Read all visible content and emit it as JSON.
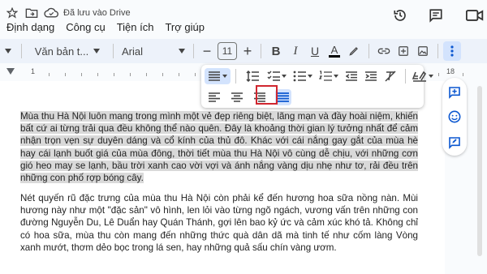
{
  "header": {
    "save_status": "Đã lưu vào Drive",
    "menus": [
      "Định dạng",
      "Công cụ",
      "Tiện ích",
      "Trợ giúp"
    ]
  },
  "toolbar": {
    "style_dropdown": "Văn bản t...",
    "font_dropdown": "Arial",
    "font_size": "11"
  },
  "ruler": {
    "left_label": "1",
    "right_label": "18"
  },
  "document": {
    "paragraph1": "Mùa thu Hà Nội luôn mang trong mình một vẻ đẹp riêng biệt, lãng mạn và đầy hoài niệm, khiến bất cứ ai từng trải qua đều không thể nào quên. Đây là khoảng thời gian lý tưởng nhất để cảm nhận trọn vẹn sự duyên dáng và cổ kính của thủ đô. Khác với cái nắng gay gắt của mùa hè hay cái lạnh buốt giá của mùa đông, thời tiết mùa thu Hà Nội vô cùng dễ chịu, với những cơn gió heo may se lạnh, bầu trời xanh cao vời vợi và ánh nắng vàng dịu nhẹ như tơ, rải đều trên những con phố rợp bóng cây.",
    "paragraph2": "Nét quyến rũ đặc trưng của mùa thu Hà Nội còn phải kể đến hương hoa sữa nồng nàn. Mùi hương này như một \"đặc sản\" vô hình, len lỏi vào từng ngõ ngách, vương vấn trên những con đường Nguyễn Du, Lê Duẩn hay Quán Thánh, gợi lên bao kỷ ức và cảm xúc khó tả. Không chỉ có hoa sữa, mùa thu còn mang đến những thức quà dân dã mà tinh tế như cốm làng Vòng xanh mướt, thơm dẻo bọc trong lá sen, hay những quả sấu chín vàng ươm."
  },
  "colors": {
    "accent": "#0b57d0",
    "highlight_border": "#d0262f",
    "selection": "#d9d9d9"
  }
}
